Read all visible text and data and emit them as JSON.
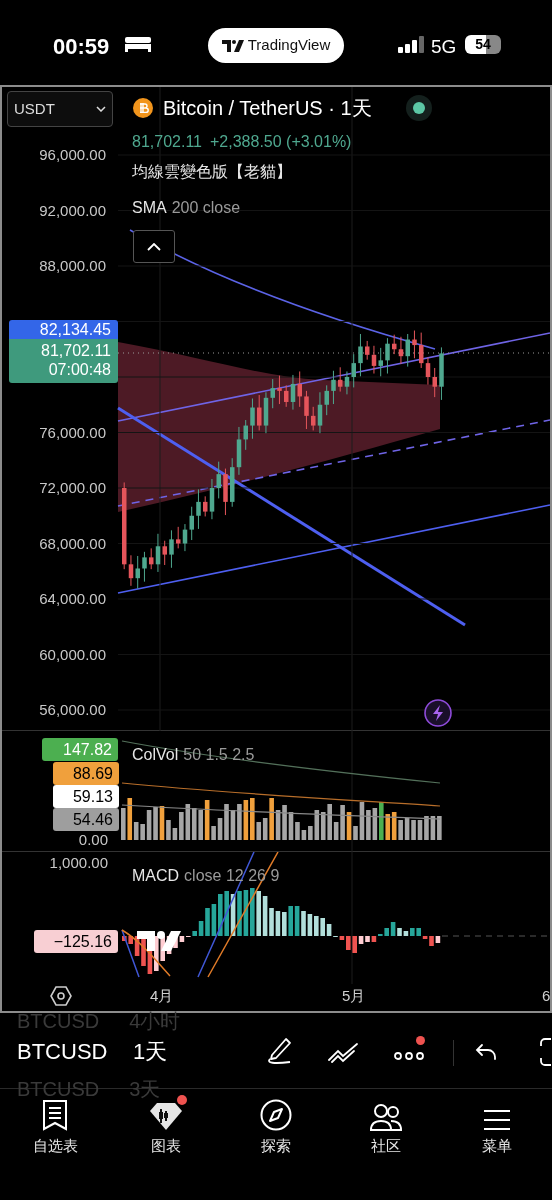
{
  "status_bar": {
    "time": "00:59",
    "app_pill": "TradingView",
    "network": "5G",
    "battery": "54"
  },
  "chart": {
    "currency_select": "USDT",
    "symbol_title": "Bitcoin / TetherUS · 1天",
    "quote": {
      "price": "81,702.11",
      "change": "+2,388.50 (+3.01%)"
    },
    "indicators": [
      {
        "name": "均線雲變色版【老貓】"
      },
      {
        "name": "SMA",
        "params": "200 close"
      }
    ],
    "chart_data": {
      "type": "candlestick",
      "categories": [
        null,
        null,
        null,
        null,
        null,
        null,
        null,
        null,
        null,
        null,
        null,
        null,
        null,
        null,
        null,
        null,
        null,
        null,
        null,
        null,
        null,
        null,
        null,
        null,
        null,
        null,
        null,
        null,
        null,
        null,
        null,
        null,
        null,
        null,
        null,
        null,
        null,
        null,
        null,
        null,
        null,
        null,
        null,
        null,
        null,
        null,
        null,
        null
      ],
      "ylim": [
        54487,
        100901
      ],
      "grid": true,
      "yticks": [
        {
          "value": 96000,
          "label": "96,000.00"
        },
        {
          "value": 92000,
          "label": "92,000.00"
        },
        {
          "value": 88000,
          "label": "88,000.00"
        },
        {
          "value": 76000,
          "label": "76,000.00"
        },
        {
          "value": 72000,
          "label": "72,000.00"
        },
        {
          "value": 68000,
          "label": "68,000.00"
        },
        {
          "value": 64000,
          "label": "64,000.00"
        },
        {
          "value": 60000,
          "label": "60,000.00"
        },
        {
          "value": 56000,
          "label": "56,000.00"
        }
      ],
      "ohlc": [
        [
          72000,
          72400,
          66150,
          66500
        ],
        [
          66500,
          67150,
          64950,
          65500
        ],
        [
          65500,
          67100,
          64750,
          66200
        ],
        [
          66200,
          67400,
          65250,
          67000
        ],
        [
          67000,
          67650,
          66150,
          66500
        ],
        [
          66500,
          68700,
          65950,
          67800
        ],
        [
          67800,
          68200,
          66450,
          67200
        ],
        [
          67200,
          68950,
          66250,
          68300
        ],
        [
          68300,
          69200,
          67650,
          68000
        ],
        [
          68000,
          69400,
          67450,
          69000
        ],
        [
          69000,
          70650,
          68250,
          70000
        ],
        [
          70000,
          71900,
          69050,
          71000
        ],
        [
          71000,
          71400,
          69950,
          70300
        ],
        [
          70300,
          72650,
          69750,
          72000
        ],
        [
          72000,
          73900,
          71250,
          73000
        ],
        [
          73000,
          73400,
          70050,
          71000
        ],
        [
          71000,
          74150,
          70650,
          73500
        ],
        [
          73500,
          76400,
          72950,
          75500
        ],
        [
          75500,
          76900,
          74750,
          76500
        ],
        [
          76500,
          78450,
          75550,
          77800
        ],
        [
          77800,
          78700,
          76150,
          76500
        ],
        [
          76500,
          78900,
          75950,
          78500
        ],
        [
          78500,
          79850,
          77750,
          79200
        ],
        [
          79200,
          80100,
          78050,
          79000
        ],
        [
          79000,
          79400,
          77850,
          78200
        ],
        [
          78200,
          80150,
          77650,
          79500
        ],
        [
          79500,
          80400,
          77850,
          78600
        ],
        [
          78600,
          79000,
          76250,
          77200
        ],
        [
          77200,
          77850,
          76150,
          76500
        ],
        [
          76500,
          78900,
          75950,
          78000
        ],
        [
          78000,
          79400,
          77250,
          79000
        ],
        [
          79000,
          80450,
          78050,
          79800
        ],
        [
          79800,
          80700,
          78950,
          79300
        ],
        [
          79300,
          80400,
          78750,
          80000
        ],
        [
          80000,
          81650,
          79250,
          81000
        ],
        [
          81000,
          83100,
          80050,
          82200
        ],
        [
          82200,
          82600,
          81250,
          81600
        ],
        [
          81600,
          82250,
          80250,
          80800
        ],
        [
          80800,
          82100,
          80050,
          81200
        ],
        [
          81200,
          82800,
          80250,
          82400
        ],
        [
          82400,
          83050,
          81650,
          82000
        ],
        [
          82000,
          82900,
          80950,
          81500
        ],
        [
          81500,
          83100,
          80750,
          82700
        ],
        [
          82700,
          83350,
          81350,
          82300
        ],
        [
          82300,
          83200,
          80650,
          81000
        ],
        [
          81000,
          81400,
          79450,
          80000
        ],
        [
          80000,
          80650,
          78550,
          79300
        ],
        [
          79300,
          82134,
          78350,
          81702
        ]
      ]
    },
    "high_tag": "82,134.45",
    "last_price_tag": {
      "price": "81,702.11",
      "countdown": "07:00:48"
    }
  },
  "volume": {
    "name": "ColVol",
    "params": "50 1.5 2.5",
    "tags": [
      {
        "value": "147.82",
        "color": "#4caf50"
      },
      {
        "value": "88.69",
        "color": "#f0a03c"
      },
      {
        "value": "59.13",
        "color": "#ffffff"
      },
      {
        "value": "54.46",
        "color": "#9e9e9e"
      }
    ],
    "zero": "0.00"
  },
  "macd": {
    "top_label": "1,000.00",
    "name": "MACD",
    "params": "close 12 26 9",
    "value_tag": "−125.16"
  },
  "time_axis": [
    "4月",
    "5月",
    "6"
  ],
  "toolbar": {
    "symbol": "BTCUSD",
    "interval": "1天",
    "picker_above": {
      "symbol": "BTCUSD",
      "interval": "4小时"
    },
    "picker_below": {
      "symbol": "BTCUSD",
      "interval": "3天"
    },
    "more_badge": true
  },
  "nav": [
    {
      "label": "自选表",
      "kind": "watchlist",
      "badge": false
    },
    {
      "label": "图表",
      "kind": "chart",
      "badge": true
    },
    {
      "label": "探索",
      "kind": "explore",
      "badge": false
    },
    {
      "label": "社区",
      "kind": "community",
      "badge": false
    },
    {
      "label": "菜单",
      "kind": "menu",
      "badge": false
    }
  ]
}
